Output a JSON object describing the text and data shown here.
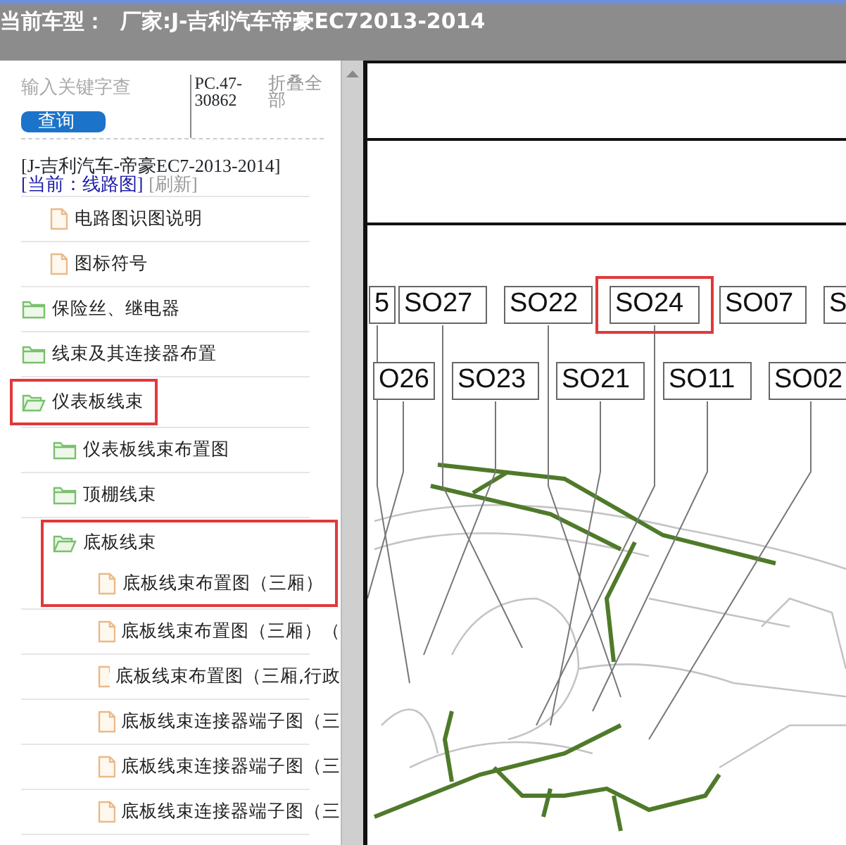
{
  "header": {
    "title": "当前车型：  厂家:J-吉利汽车帝豪EC72013-2014"
  },
  "search": {
    "placeholder": "输入关键字查",
    "button": "查询"
  },
  "part_number": "PC.47-30862",
  "collapse_all": "折叠全部",
  "model": "[J-吉利汽车-帝豪EC7-2013-2014]",
  "current": "[当前：线路图]",
  "refresh": "[刷新]",
  "tree": [
    {
      "kind": "file",
      "label": "电路图识图说明",
      "highlighted": false
    },
    {
      "kind": "file",
      "label": "图标符号",
      "highlighted": false
    },
    {
      "kind": "folder",
      "label": "保险丝、继电器",
      "expanded": false,
      "highlighted": false
    },
    {
      "kind": "folder",
      "label": "线束及其连接器布置",
      "expanded": false,
      "highlighted": false
    },
    {
      "kind": "folder",
      "label": "仪表板线束",
      "expanded": true,
      "highlighted": true,
      "children": [
        {
          "kind": "folder",
          "label": "仪表板线束布置图",
          "expanded": false,
          "highlighted": false
        },
        {
          "kind": "folder",
          "label": "顶棚线束",
          "expanded": false,
          "highlighted": false
        },
        {
          "kind": "folder",
          "label": "底板线束",
          "expanded": true,
          "highlighted": true,
          "children": [
            {
              "kind": "file",
              "label": "底板线束布置图（三厢）",
              "highlighted": true
            },
            {
              "kind": "file",
              "label": "底板线束布置图（三厢）（",
              "highlighted": false
            },
            {
              "kind": "file",
              "label": "底板线束布置图（三厢,行政",
              "highlighted": false
            },
            {
              "kind": "file",
              "label": "底板线束连接器端子图（三",
              "highlighted": false
            },
            {
              "kind": "file",
              "label": "底板线束连接器端子图（三",
              "highlighted": false
            },
            {
              "kind": "file",
              "label": "底板线束连接器端子图（三",
              "highlighted": false
            }
          ]
        }
      ]
    }
  ],
  "diagram": {
    "label_rows": [
      [
        {
          "text": "5",
          "highlighted": false
        },
        {
          "text": "SO27",
          "highlighted": false
        },
        {
          "text": "SO22",
          "highlighted": false
        },
        {
          "text": "SO24",
          "highlighted": true
        },
        {
          "text": "SO07",
          "highlighted": false
        },
        {
          "text": "S",
          "highlighted": false
        }
      ],
      [
        {
          "text": "O26",
          "highlighted": false
        },
        {
          "text": "SO23",
          "highlighted": false
        },
        {
          "text": "SO21",
          "highlighted": false
        },
        {
          "text": "SO11",
          "highlighted": false
        },
        {
          "text": "SO02",
          "highlighted": false
        }
      ]
    ]
  }
}
